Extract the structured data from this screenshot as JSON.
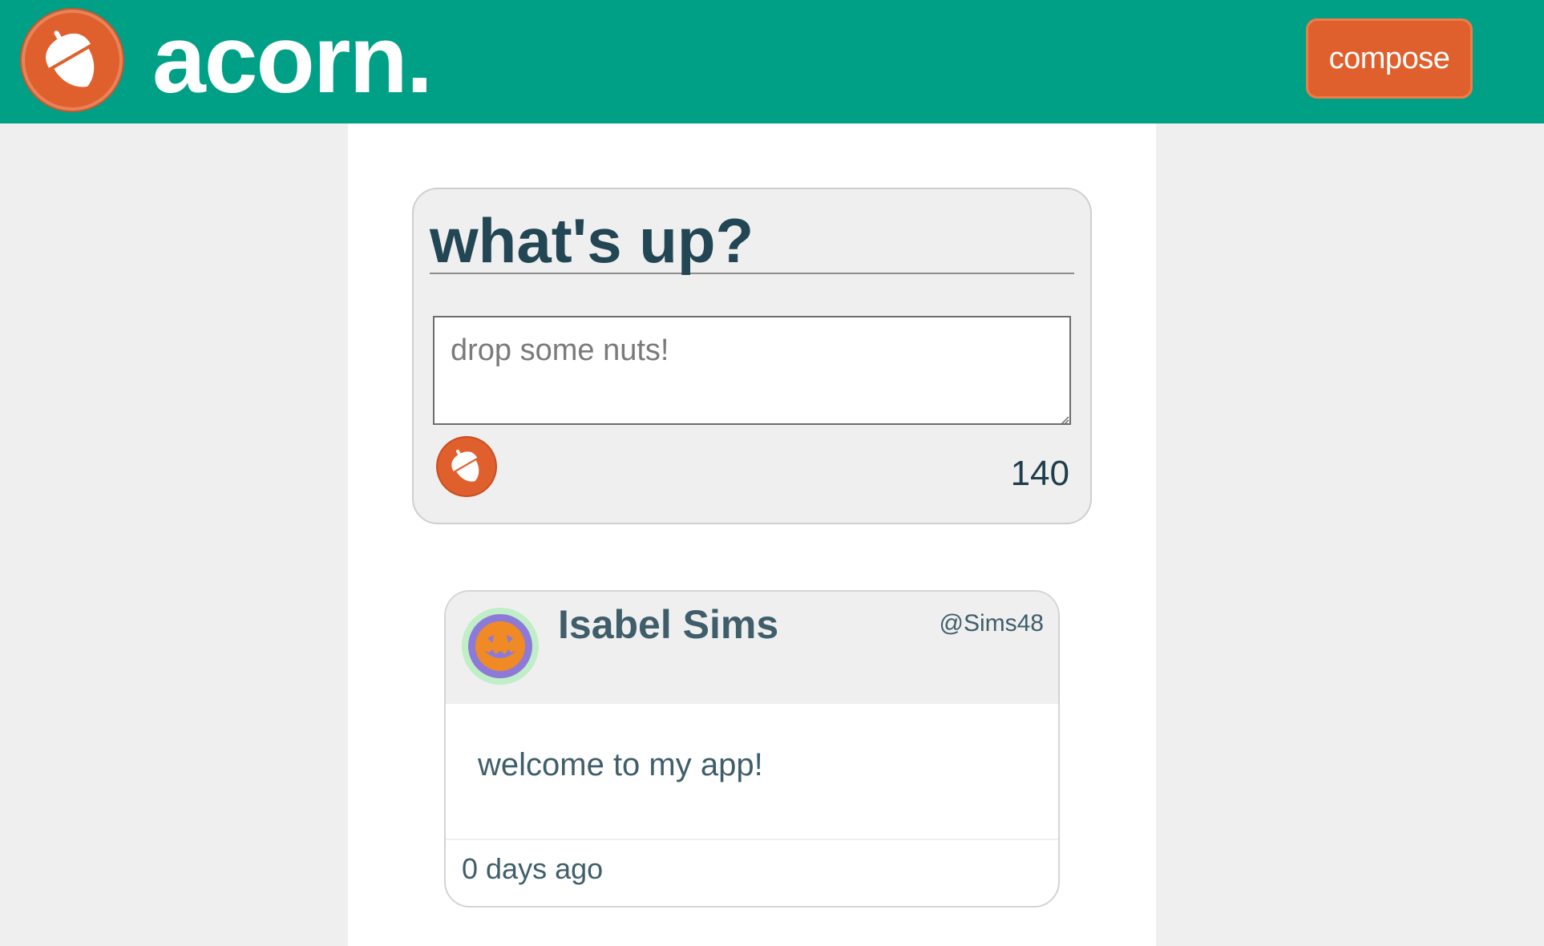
{
  "header": {
    "brand": "acorn.",
    "compose_label": "compose",
    "logo_icon": "acorn-icon",
    "background_color": "#00a087",
    "accent_color": "#e0602d"
  },
  "composer": {
    "title": "what's up?",
    "placeholder": "drop some nuts!",
    "value": "",
    "submit_icon": "acorn-icon",
    "char_count": "140"
  },
  "post": {
    "author_name": "Isabel Sims",
    "author_handle": "@Sims48",
    "avatar_icon": "pumpkin-avatar",
    "text": "welcome to my app!",
    "timestamp": "0 days ago"
  },
  "colors": {
    "page_background": "#efefef",
    "text_dark": "#234654",
    "text_muted": "#3f5e6a"
  }
}
